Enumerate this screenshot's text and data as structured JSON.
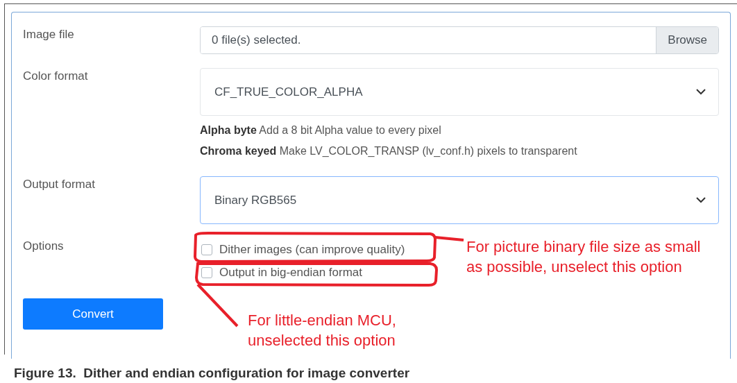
{
  "form": {
    "rows": [
      {
        "kind": "file",
        "label": "Image file",
        "placeholder": "0 file(s) selected.",
        "button": "Browse"
      },
      {
        "kind": "select",
        "label": "Color format",
        "value": "CF_TRUE_COLOR_ALPHA",
        "focused": false,
        "hints": [
          "**Alpha byte** Add a 8 bit Alpha value to every pixel",
          "**Chroma keyed** Make LV_COLOR_TRANSP (lv_conf.h) pixels to transparent"
        ]
      },
      {
        "kind": "select",
        "label": "Output format",
        "value": "Binary RGB565",
        "focused": true
      },
      {
        "kind": "options",
        "label": "Options",
        "options": [
          {
            "label": "Dither images (can improve quality)",
            "checked": false
          },
          {
            "label": "Output in big-endian format",
            "checked": false
          }
        ]
      }
    ],
    "submit": "Convert"
  },
  "annotations": [
    {
      "text": "For picture binary file size as small as possible, unselect this option"
    },
    {
      "text": "For little-endian MCU, unselected this option"
    }
  ],
  "caption": "Figure 13.  Dither and endian configuration for image converter"
}
